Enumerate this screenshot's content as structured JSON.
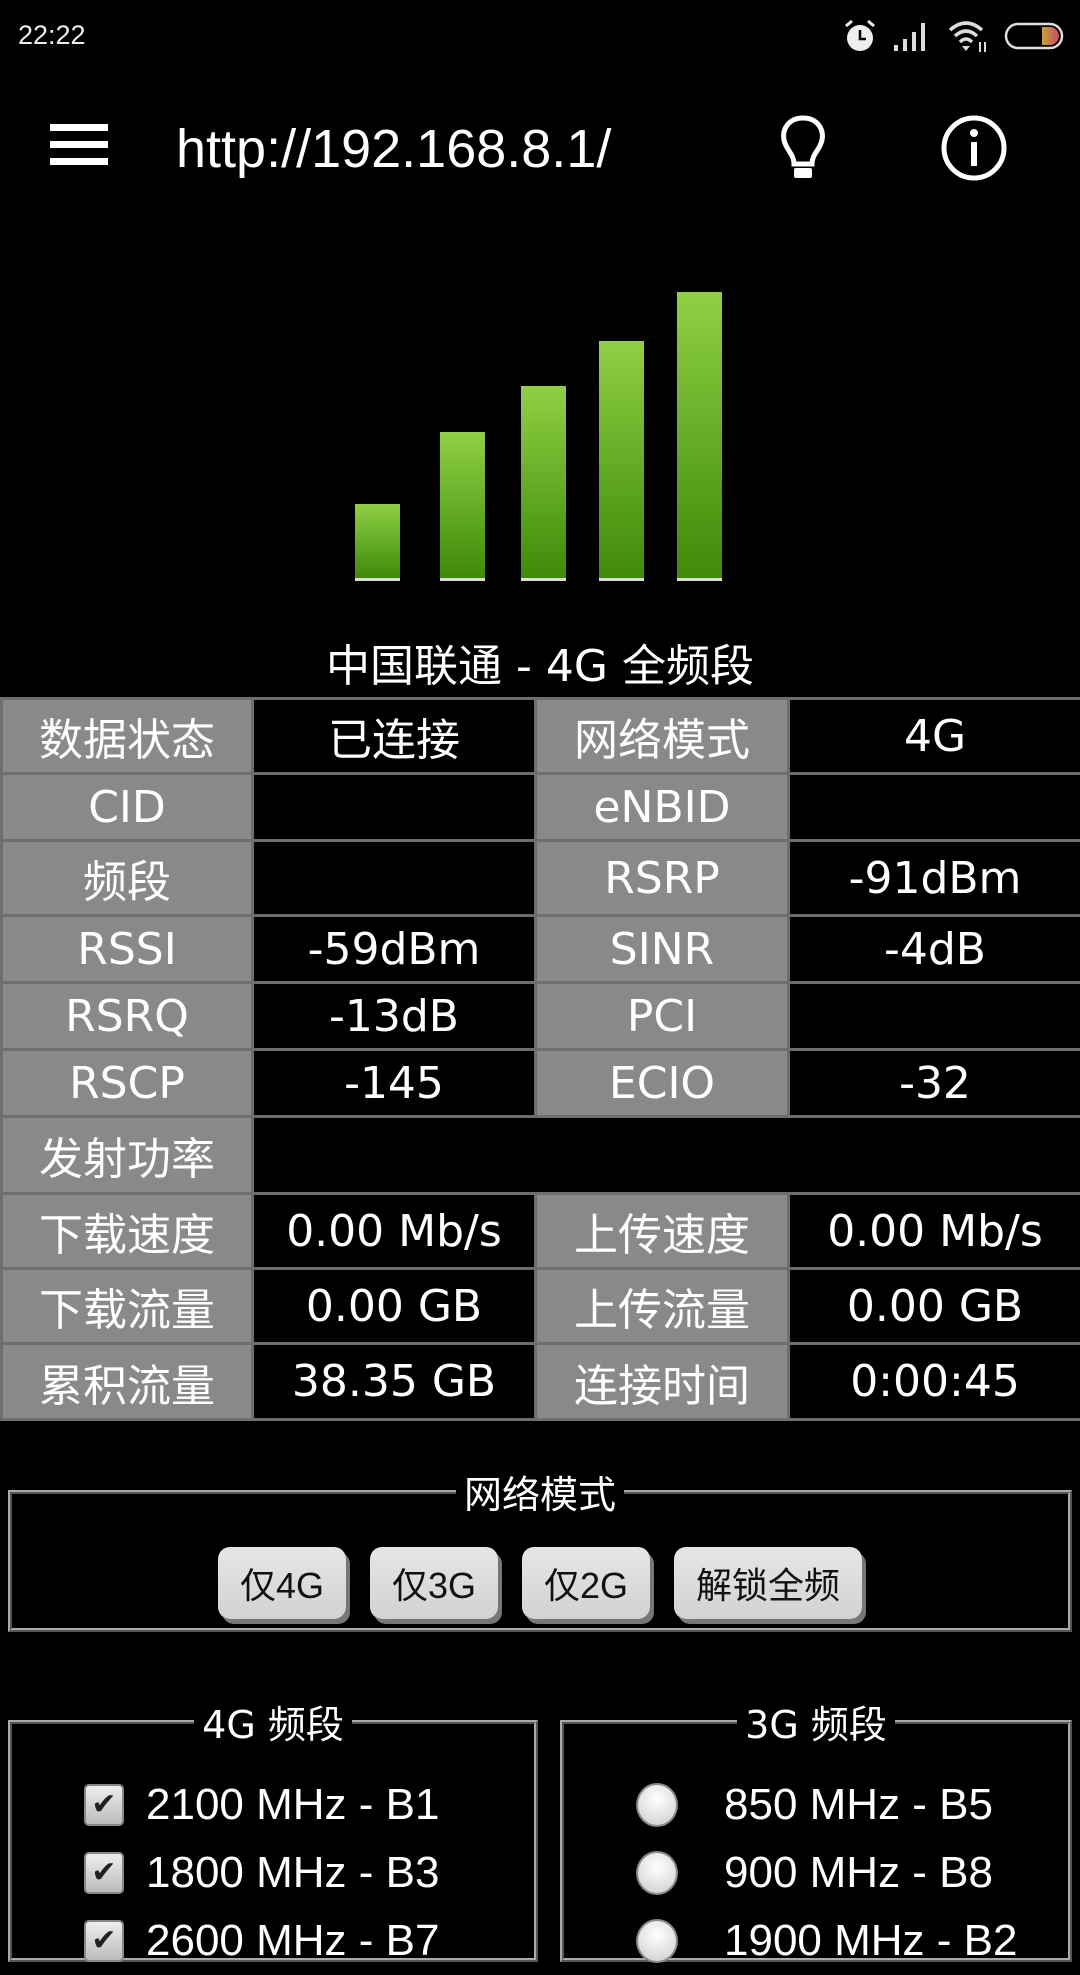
{
  "status_bar": {
    "time": "22:22",
    "icons": [
      "alarm-icon",
      "cellular-signal-icon",
      "wifi-icon",
      "battery-icon"
    ],
    "battery_color": "#c06050"
  },
  "app_bar": {
    "menu_icon": "hamburger-menu-icon",
    "url": "http://192.168.8.1/",
    "bulb_icon": "lightbulb-icon",
    "info_icon": "info-icon"
  },
  "signal": {
    "bars_total": 5,
    "bars_active": 5,
    "bar_color": "#6cc02a"
  },
  "carrier_line": "中国联通 - 4G 全频段",
  "info_table": {
    "rows": [
      [
        {
          "label": "数据状态",
          "value": "已连接"
        },
        {
          "label": "网络模式",
          "value": "4G"
        }
      ],
      [
        {
          "label": "CID",
          "value": ""
        },
        {
          "label": "eNBID",
          "value": ""
        }
      ],
      [
        {
          "label": "频段",
          "value": ""
        },
        {
          "label": "RSRP",
          "value": "-91dBm"
        }
      ],
      [
        {
          "label": "RSSI",
          "value": "-59dBm"
        },
        {
          "label": "SINR",
          "value": "-4dB"
        }
      ],
      [
        {
          "label": "RSRQ",
          "value": "-13dB"
        },
        {
          "label": "PCI",
          "value": ""
        }
      ],
      [
        {
          "label": "RSCP",
          "value": "-145"
        },
        {
          "label": "ECIO",
          "value": "-32"
        }
      ],
      [
        {
          "label": "发射功率",
          "value": ""
        }
      ],
      [
        {
          "label": "下载速度",
          "value": "0.00 Mb/s"
        },
        {
          "label": "上传速度",
          "value": "0.00 Mb/s"
        }
      ],
      [
        {
          "label": "下载流量",
          "value": "0.00 GB"
        },
        {
          "label": "上传流量",
          "value": "0.00 GB"
        }
      ],
      [
        {
          "label": "累积流量",
          "value": "38.35 GB"
        },
        {
          "label": "连接时间",
          "value": "0:00:45"
        }
      ]
    ]
  },
  "network_mode": {
    "legend": "网络模式",
    "buttons": [
      "仅4G",
      "仅3G",
      "仅2G",
      "解锁全频"
    ]
  },
  "band_4g": {
    "legend": "4G 频段",
    "items": [
      {
        "label": "2100 MHz - B1",
        "checked": true
      },
      {
        "label": "1800 MHz - B3",
        "checked": true
      },
      {
        "label": "2600 MHz - B7",
        "checked": true
      }
    ]
  },
  "band_3g": {
    "legend": "3G 频段",
    "items": [
      {
        "label": "850 MHz - B5",
        "selected": false
      },
      {
        "label": "900 MHz - B8",
        "selected": false
      },
      {
        "label": "1900 MHz - B2",
        "selected": false
      }
    ]
  }
}
